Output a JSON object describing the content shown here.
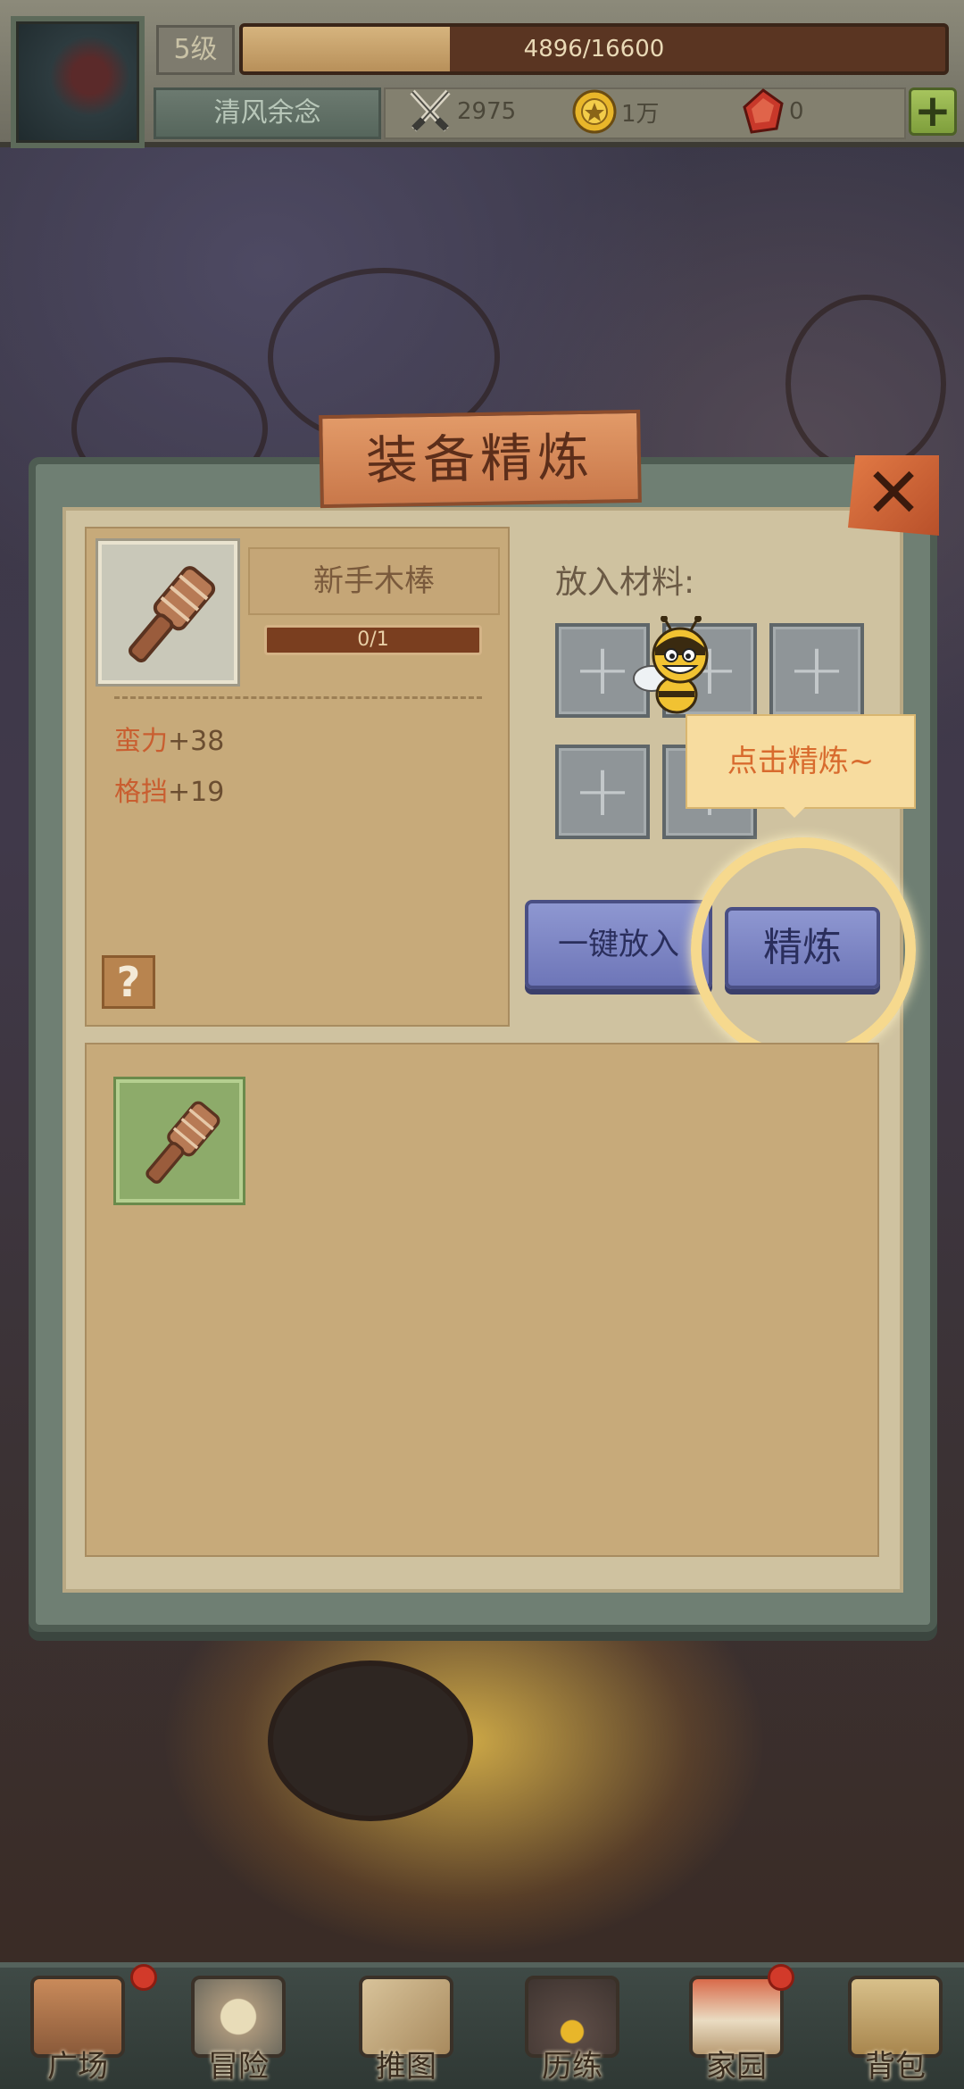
{
  "hud": {
    "level": "5级",
    "exp_text": "4896/16600",
    "exp_progress": 0.295,
    "player_name": "清风余念",
    "attack": "2975",
    "gold": "1万",
    "gems": "0",
    "plus": "+"
  },
  "panel": {
    "title": "装备精炼",
    "close": "✕",
    "item_name": "新手木棒",
    "refine_progress": "0/1",
    "stats": [
      {
        "label": "蛮力",
        "value": "+38"
      },
      {
        "label": "格挡",
        "value": "+19"
      }
    ],
    "help": "?",
    "material_label": "放入材料:",
    "slot_plus": "+",
    "auto_fill_button": "一键放入",
    "refine_button": "精炼",
    "tooltip": "点击精炼~"
  },
  "nav": {
    "items": [
      {
        "label": "广场",
        "badge": true
      },
      {
        "label": "冒险",
        "badge": false
      },
      {
        "label": "推图",
        "badge": false
      },
      {
        "label": "历练",
        "badge": false
      },
      {
        "label": "家园",
        "badge": true
      },
      {
        "label": "背包",
        "badge": false
      }
    ]
  },
  "colors": {
    "panel_frame": "#6f7f73",
    "card": "#c7aa7a",
    "button_purple": "#8e97d1",
    "tooltip_text": "#d86b2e",
    "stat_label": "#c95e30"
  }
}
